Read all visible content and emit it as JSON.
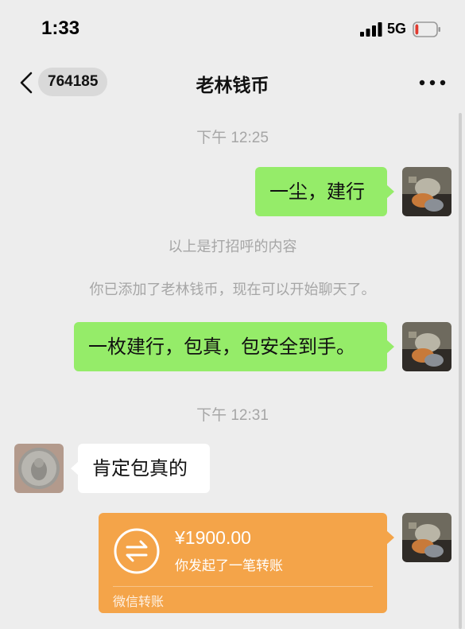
{
  "status_bar": {
    "time": "1:33",
    "network": "5G",
    "battery_level": 0.15,
    "battery_color": "#e03a2f"
  },
  "nav": {
    "back_icon": "chevron-left-icon",
    "unread_count": "764185",
    "title": "老林钱币",
    "more_icon": "more-horizontal-icon"
  },
  "chat": {
    "timestamp_1": "下午 12:25",
    "msg_1": "一尘，建行",
    "system_1": "以上是打招呼的内容",
    "system_2": "你已添加了老林钱币，现在可以开始聊天了。",
    "msg_2": "一枚建行，包真，包安全到手。",
    "timestamp_2": "下午 12:31",
    "msg_3": "肯定包真的",
    "transfer": {
      "amount": "¥1900.00",
      "description": "你发起了一笔转账",
      "footer": "微信转账",
      "icon": "transfer-arrows-icon"
    }
  },
  "colors": {
    "background": "#ededed",
    "outgoing_bubble": "#95ec69",
    "incoming_bubble": "#ffffff",
    "transfer_card": "#f4a449"
  }
}
